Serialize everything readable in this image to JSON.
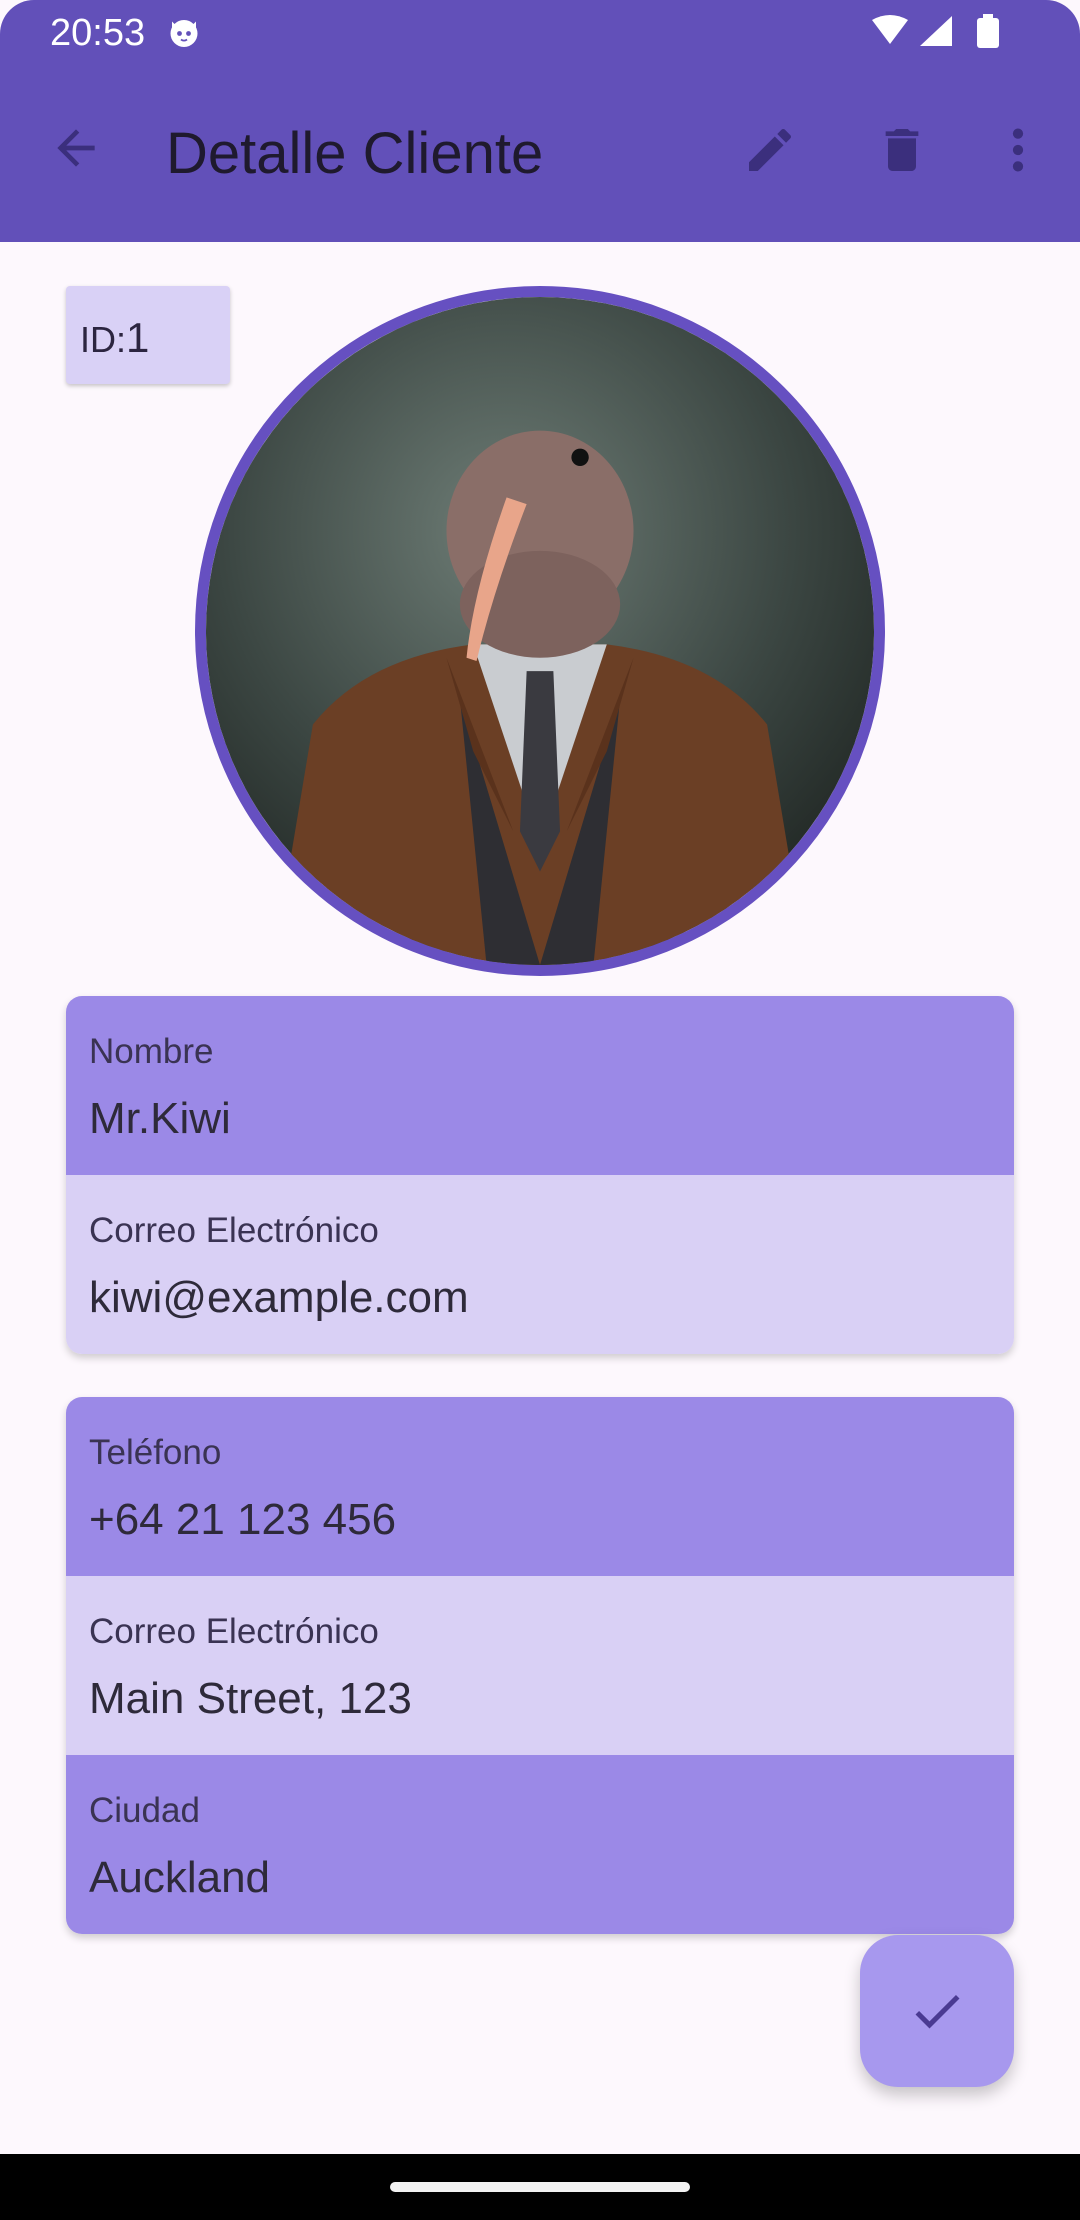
{
  "status_bar": {
    "time": "20:53",
    "icons": [
      "cat-face-icon",
      "wifi-icon",
      "signal-icon",
      "battery-icon"
    ]
  },
  "app_bar": {
    "title": "Detalle Cliente",
    "back_icon": "arrow-back-icon",
    "edit_icon": "pencil-icon",
    "delete_icon": "trash-icon",
    "more_icon": "more-vert-icon"
  },
  "client": {
    "id_label": "ID:",
    "id_value": "1",
    "photo_alt": "kiwi-in-suit-portrait"
  },
  "card1": {
    "name_label": "Nombre",
    "name_value": "Mr.Kiwi",
    "email_label": "Correo Electrónico",
    "email_value": "kiwi@example.com"
  },
  "card2": {
    "phone_label": "Teléfono",
    "phone_value": "+64 21 123 456",
    "address_label": "Correo Electrónico",
    "address_value": "Main Street, 123",
    "city_label": "Ciudad",
    "city_value": "Auckland"
  },
  "fab": {
    "icon": "check-icon"
  },
  "colors": {
    "primary": "#6250b9",
    "field_dark": "#9b89e7",
    "field_light": "#d9d0f5",
    "fab": "#a798ee"
  }
}
